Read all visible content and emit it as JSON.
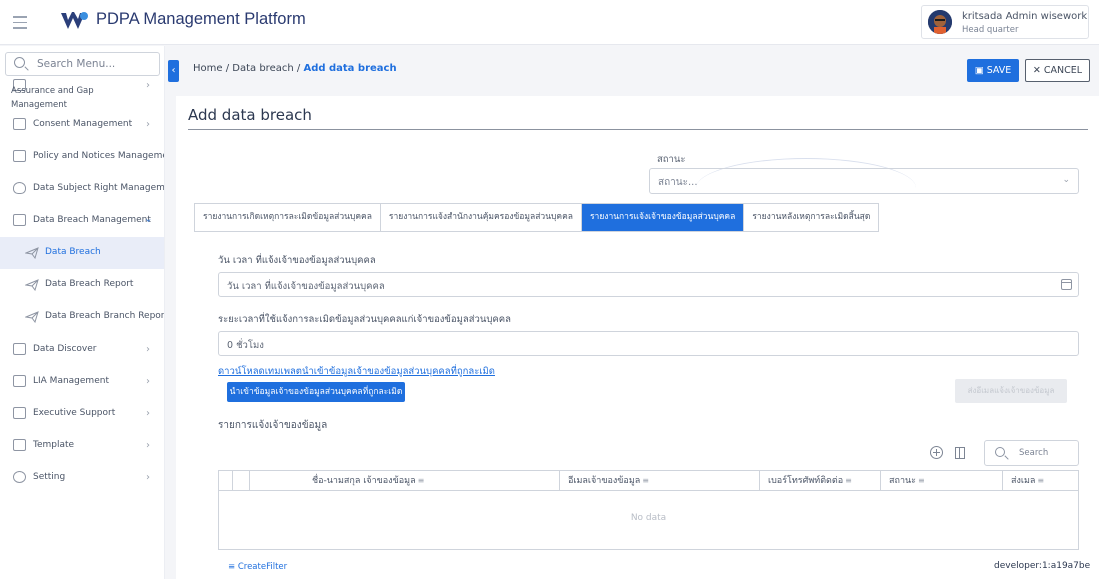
{
  "header": {
    "app_title": "PDPA Management Platform",
    "user_name": "kritsada Admin wisework",
    "user_role": "Head quarter"
  },
  "sidebar": {
    "search_placeholder": "Search Menu...",
    "items": [
      {
        "label": "Assurance and Gap Management",
        "icon": "envelope-icon"
      },
      {
        "label": "Consent Management",
        "icon": "consent-icon"
      },
      {
        "label": "Policy and Notices Management",
        "icon": "policy-icon"
      },
      {
        "label": "Data Subject Right Management",
        "icon": "shield-icon"
      },
      {
        "label": "Data Breach Management",
        "icon": "document-icon"
      },
      {
        "label": "Data Breach",
        "icon": "paper-plane-icon"
      },
      {
        "label": "Data Breach Report",
        "icon": "paper-plane-icon"
      },
      {
        "label": "Data Breach Branch Report",
        "icon": "paper-plane-icon"
      },
      {
        "label": "Data Discover",
        "icon": "discover-icon"
      },
      {
        "label": "LIA Management",
        "icon": "lia-icon"
      },
      {
        "label": "Executive Support",
        "icon": "calendar-icon"
      },
      {
        "label": "Template",
        "icon": "template-icon"
      },
      {
        "label": "Setting",
        "icon": "gear-icon"
      }
    ]
  },
  "breadcrumb": {
    "home": "Home",
    "sep": "/",
    "parent": "Data breach",
    "current": "Add data breach"
  },
  "toolbar": {
    "save_label": "SAVE",
    "cancel_label": "CANCEL"
  },
  "form": {
    "title": "Add data breach",
    "status_label": "สถานะ",
    "status_placeholder": "สถานะ...",
    "tabs": [
      "รายงานการเกิดเหตุการละเมิดข้อมูลส่วนบุคคล",
      "รายงานการแจ้งสำนักงานคุ้มครองข้อมูลส่วนบุคคล",
      "รายงานการแจ้งเจ้าของข้อมูลส่วนบุคคล",
      "รายงานหลังเหตุการละเมิดสิ้นสุด"
    ],
    "active_tab_index": 2,
    "notify_datetime_label": "วัน เวลา ที่แจ้งเจ้าของข้อมูลส่วนบุคคล",
    "notify_datetime_placeholder": "วัน เวลา ที่แจ้งเจ้าของข้อมูลส่วนบุคคล",
    "duration_label": "ระยะเวลาที่ใช้แจ้งการละเมิดข้อมูลส่วนบุคคลแก่เจ้าของข้อมูลส่วนบุคคล",
    "duration_value": "0 ชั่วโมง",
    "download_link": "ดาวน์โหลดเทมเพลตนำเข้าข้อมูลเจ้าของข้อมูลส่วนบุคคลที่ถูกละเมิด",
    "import_button": "นำเข้าข้อมูลเจ้าของข้อมูลส่วนบุคคลที่ถูกละเมิด",
    "notify_button": "ส่งอีเมลแจ้งเจ้าของข้อมูล",
    "list_label": "รายการแจ้งเจ้าของข้อมูล",
    "table_search_placeholder": "Search",
    "columns": [
      "",
      "",
      "ชื่อ-นามสกุล เจ้าของข้อมูล",
      "อีเมลเจ้าของข้อมูล",
      "เบอร์โทรศัพท์ติดต่อ",
      "สถานะ",
      "ส่งเมล"
    ],
    "no_data": "No data",
    "create_filter": "CreateFilter",
    "dev_tag": "developer:1:a19a7be"
  }
}
